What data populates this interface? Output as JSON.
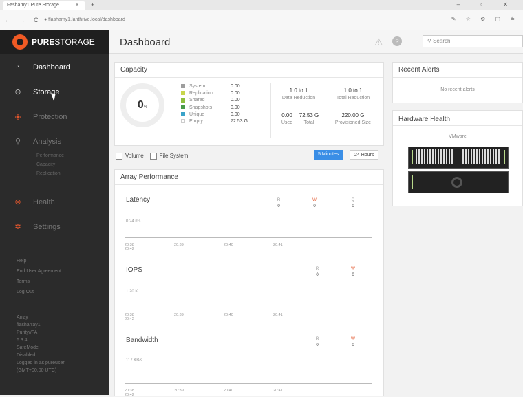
{
  "browser": {
    "tab_title": "Fashamy1 Pure Storage",
    "tab_close": "×",
    "new_tab": "+",
    "window_controls": "– ▫ ✕",
    "nav_buttons": "← → C",
    "url": "● flashamy1.lanthrive.local/dashboard",
    "extensions": "✎ ☆ ⚙ ▢ ≗"
  },
  "brand": {
    "name_bold": "PURE",
    "name_light": "STORAGE"
  },
  "sidebar": {
    "items": [
      {
        "label": "Dashboard",
        "icon": "dashboard-icon"
      },
      {
        "label": "Storage",
        "icon": "storage-icon"
      },
      {
        "label": "Protection",
        "icon": "shield-icon"
      },
      {
        "label": "Analysis",
        "icon": "magnify-icon"
      },
      {
        "label": "Health",
        "icon": "health-icon"
      },
      {
        "label": "Settings",
        "icon": "gear-icon"
      }
    ],
    "analysis_sub": [
      "Performance",
      "Capacity",
      "Replication"
    ],
    "links": [
      "Help",
      "End User Agreement",
      "Terms",
      "Log Out"
    ],
    "info": [
      "Array",
      "flasharray1",
      "Purity//FA",
      "6.3.4",
      "SafeMode",
      "Disabled",
      "Logged in as pureuser",
      "(GMT+00:00 UTC)"
    ]
  },
  "header": {
    "title": "Dashboard",
    "search_placeholder": "Search"
  },
  "capacity": {
    "title": "Capacity",
    "percent": "0",
    "percent_unit": "%",
    "legend": [
      {
        "label": "System",
        "value": "0.00",
        "color": "#9e9e9e"
      },
      {
        "label": "Replication",
        "value": "0.00",
        "color": "#c8d64c"
      },
      {
        "label": "Shared",
        "value": "0.00",
        "color": "#8fbf3f"
      },
      {
        "label": "Snapshots",
        "value": "0.00",
        "color": "#4a9b4a"
      },
      {
        "label": "Unique",
        "value": "0.00",
        "color": "#3aa3c9"
      },
      {
        "label": "Empty",
        "value": "72.53 G",
        "color": "#ffffff"
      }
    ],
    "data_reduction": {
      "value": "1.0 to 1",
      "label": "Data Reduction"
    },
    "total_reduction": {
      "value": "1.0 to 1",
      "label": "Total Reduction"
    },
    "used": {
      "value": "0.00",
      "label": "Used"
    },
    "total": {
      "value": "72.53 G",
      "label": "Total"
    },
    "provisioned": {
      "value": "220.00 G",
      "label": "Provisioned Size"
    }
  },
  "filters": {
    "volume": "Volume",
    "file_system": "File System",
    "range_active": "5 Minutes",
    "range_other": "24 Hours"
  },
  "performance": {
    "title": "Array Performance",
    "ticks": [
      "20:38",
      "20:39",
      "20:40",
      "20:41",
      "20:42"
    ],
    "latency": {
      "title": "Latency",
      "scale": "0.24 ms",
      "r_label": "R",
      "r_val": "0",
      "w_label": "W",
      "w_val": "0",
      "q_label": "Q",
      "q_val": "0"
    },
    "iops": {
      "title": "IOPS",
      "scale": "1.20 K",
      "r_label": "R",
      "r_val": "0",
      "w_label": "W",
      "w_val": "0"
    },
    "bandwidth": {
      "title": "Bandwidth",
      "scale": "117 KB/s",
      "r_label": "R",
      "r_val": "0",
      "w_label": "W",
      "w_val": "0"
    }
  },
  "alerts": {
    "title": "Recent Alerts",
    "empty": "No recent alerts"
  },
  "hardware": {
    "title": "Hardware Health",
    "label": "VMware"
  },
  "colors": {
    "accent": "#f05a24",
    "active_range": "#3a8ee6"
  }
}
